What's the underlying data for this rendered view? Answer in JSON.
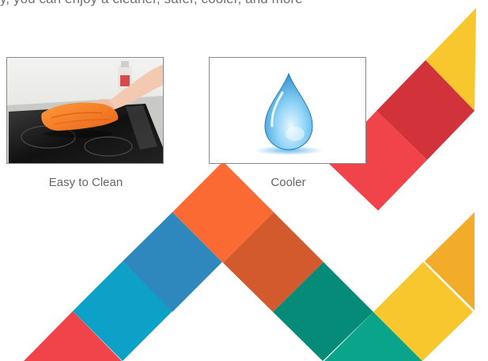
{
  "intro_text": "y, you can enjoy a cleaner, safer, cooler, and more",
  "features": [
    {
      "label": "Easy to Clean",
      "image": "cooktop-cleaning-photo"
    },
    {
      "label": "Cooler",
      "image": "water-drop-icon"
    }
  ],
  "colors": {
    "red": "#f0434a",
    "dark_red": "#d2333a",
    "yellow": "#f8c62d",
    "amber": "#f3ac29",
    "orange": "#fc6a33",
    "burnt_orange": "#d35a2d",
    "blue": "#2e88bd",
    "cyan": "#0ea1c8",
    "teal": "#078b79",
    "green_teal": "#0aa48b"
  }
}
